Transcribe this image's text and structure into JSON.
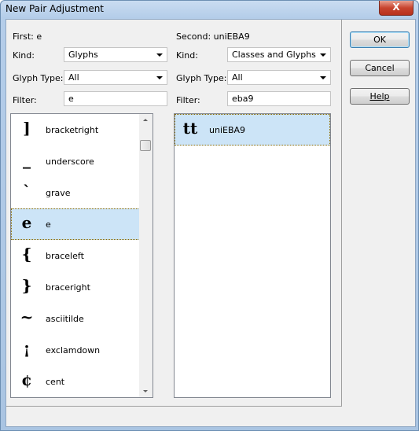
{
  "window": {
    "title": "New Pair Adjustment",
    "close_label": "X"
  },
  "first": {
    "label": "First: e",
    "kind_label": "Kind:",
    "kind_value": "Glyphs",
    "glyph_type_label": "Glyph Type:",
    "glyph_type_value": "All",
    "filter_label": "Filter:",
    "filter_value": "e",
    "items": [
      {
        "glyph": "]",
        "name": "bracketright",
        "selected": false
      },
      {
        "glyph": "_",
        "name": "underscore",
        "selected": false
      },
      {
        "glyph": "`",
        "name": "grave",
        "selected": false
      },
      {
        "glyph": "e",
        "name": "e",
        "selected": true
      },
      {
        "glyph": "{",
        "name": "braceleft",
        "selected": false
      },
      {
        "glyph": "}",
        "name": "braceright",
        "selected": false
      },
      {
        "glyph": "~",
        "name": "asciitilde",
        "selected": false
      },
      {
        "glyph": "¡",
        "name": "exclamdown",
        "selected": false
      },
      {
        "glyph": "¢",
        "name": "cent",
        "selected": false
      }
    ]
  },
  "second": {
    "label": "Second: uniEBA9",
    "kind_label": "Kind:",
    "kind_value": "Classes and Glyphs",
    "glyph_type_label": "Glyph Type:",
    "glyph_type_value": "All",
    "filter_label": "Filter:",
    "filter_value": "eba9",
    "items": [
      {
        "glyph": "tt",
        "name": "uniEBA9",
        "selected": true
      }
    ]
  },
  "buttons": {
    "ok": "OK",
    "cancel": "Cancel",
    "help": "Help"
  },
  "colors": {
    "selection": "#cce4f7",
    "dialog_bg": "#f0f0f0"
  }
}
